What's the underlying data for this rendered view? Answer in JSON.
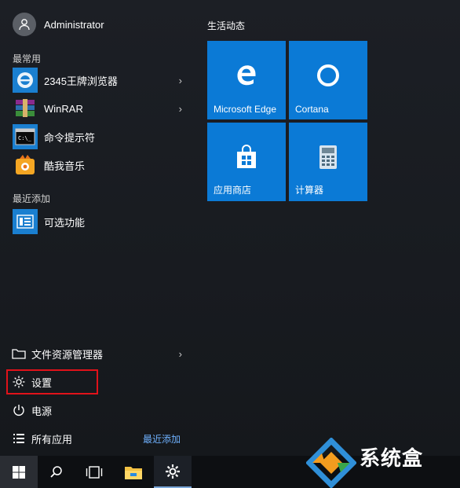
{
  "user": {
    "name": "Administrator"
  },
  "most_used": {
    "label": "最常用",
    "items": [
      {
        "label": "2345王牌浏览器",
        "icon": "browser-icon",
        "has_submenu": true
      },
      {
        "label": "WinRAR",
        "icon": "winrar-icon",
        "has_submenu": true
      },
      {
        "label": "命令提示符",
        "icon": "cmd-icon",
        "has_submenu": false
      },
      {
        "label": "酷我音乐",
        "icon": "kuwo-icon",
        "has_submenu": false
      }
    ]
  },
  "recently_added": {
    "label": "最近添加",
    "items": [
      {
        "label": "可选功能",
        "icon": "optional-features-icon"
      }
    ]
  },
  "bottom": {
    "file_explorer": "文件资源管理器",
    "settings": "设置",
    "power": "电源",
    "all_apps": "所有应用",
    "recent_link": "最近添加"
  },
  "live_tiles": {
    "title": "生活动态",
    "tiles": [
      {
        "label": "Microsoft Edge",
        "icon": "edge-icon"
      },
      {
        "label": "Cortana",
        "icon": "cortana-icon"
      },
      {
        "label": "应用商店",
        "icon": "store-icon"
      },
      {
        "label": "计算器",
        "icon": "calculator-icon"
      }
    ]
  },
  "watermark": {
    "text": "系统盒"
  },
  "colors": {
    "tile": "#0b7ad6",
    "highlight": "#e0121a",
    "link": "#6fb1ff"
  }
}
